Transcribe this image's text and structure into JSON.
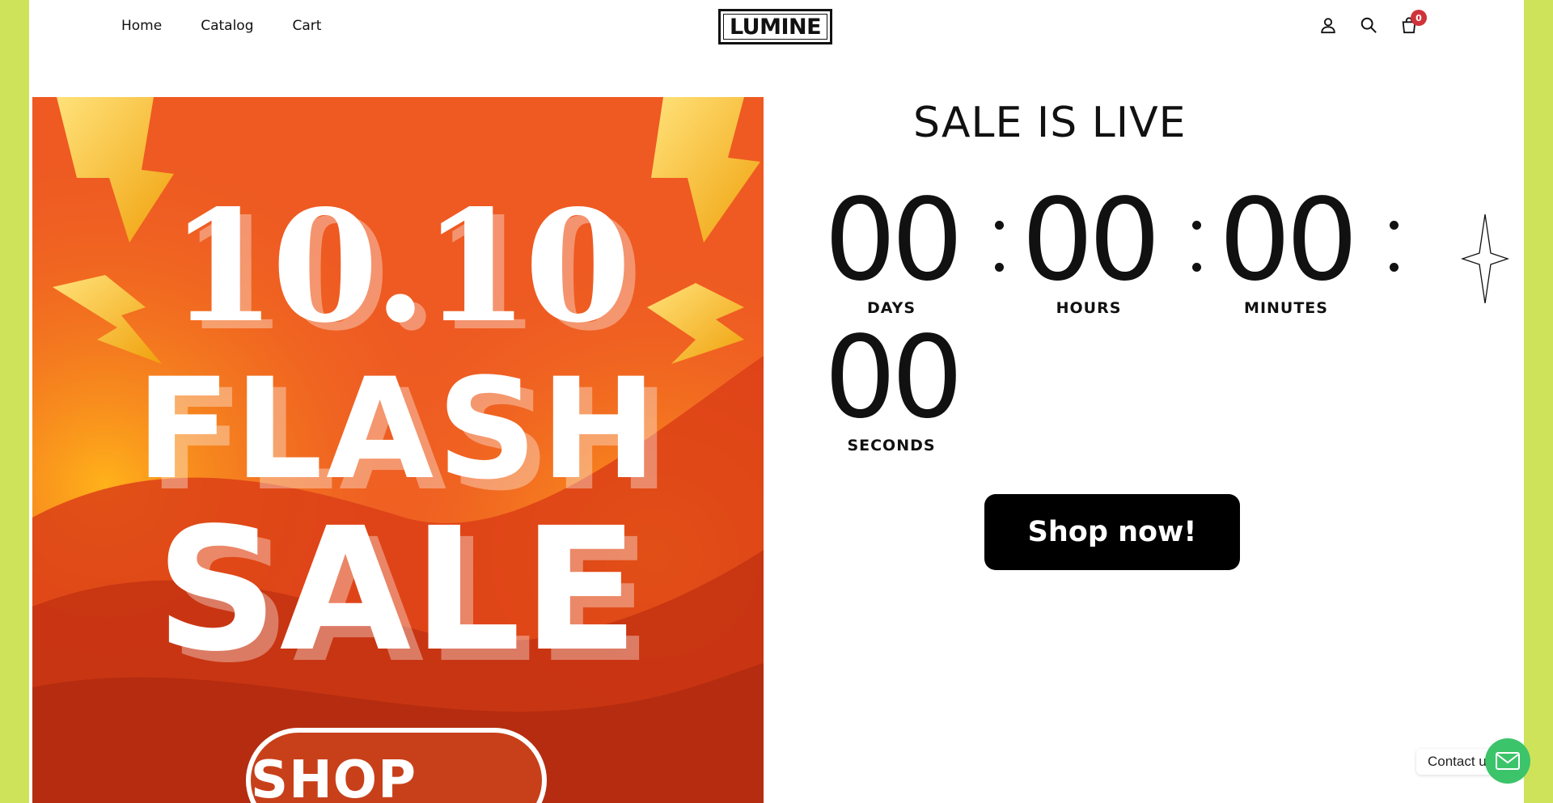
{
  "nav": {
    "items": [
      "Home",
      "Catalog",
      "Cart"
    ]
  },
  "logo": {
    "text": "LUMINE"
  },
  "header_icons": {
    "account": "user-icon",
    "search": "search-icon",
    "cart": "bag-icon",
    "cart_count": "0"
  },
  "banner": {
    "date": "10.10",
    "line1": "FLASH",
    "line2": "SALE",
    "button": "SHOP NOW"
  },
  "countdown": {
    "title": "SALE IS LIVE",
    "units": [
      {
        "value": "00",
        "label": "DAYS"
      },
      {
        "value": "00",
        "label": "HOURS"
      },
      {
        "value": "00",
        "label": "MINUTES"
      },
      {
        "value": "00",
        "label": "SECONDS"
      }
    ]
  },
  "cta": {
    "label": "Shop now!"
  },
  "contact": {
    "label": "Contact us",
    "icon": "mail-icon"
  },
  "colors": {
    "side_accent": "#cfe35a",
    "banner_orange": "#ee5a22",
    "contact_green": "#3cc46a",
    "badge_red": "#d0333a"
  }
}
